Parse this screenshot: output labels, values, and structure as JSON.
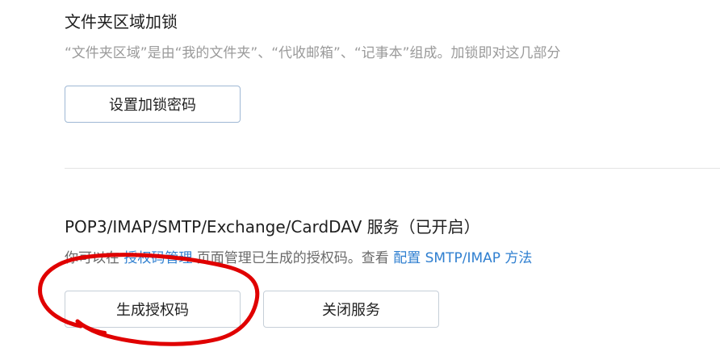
{
  "folder_lock": {
    "title": "文件夹区域加锁",
    "description": "“文件夹区域”是由“我的文件夹”、“代收邮箱”、“记事本”组成。加锁即对这几部分",
    "set_password_button": "设置加锁密码"
  },
  "service": {
    "title": "POP3/IMAP/SMTP/Exchange/CardDAV 服务（已开启）",
    "desc_prefix": "你可以在 ",
    "auth_code_link": "授权码管理",
    "desc_middle": " 页面管理已生成的授权码。查看 ",
    "config_link": "配置 SMTP/IMAP 方法",
    "generate_button": "生成授权码",
    "close_button": "关闭服务"
  },
  "colors": {
    "link": "#2f7fd0",
    "annotation": "#e00000"
  }
}
